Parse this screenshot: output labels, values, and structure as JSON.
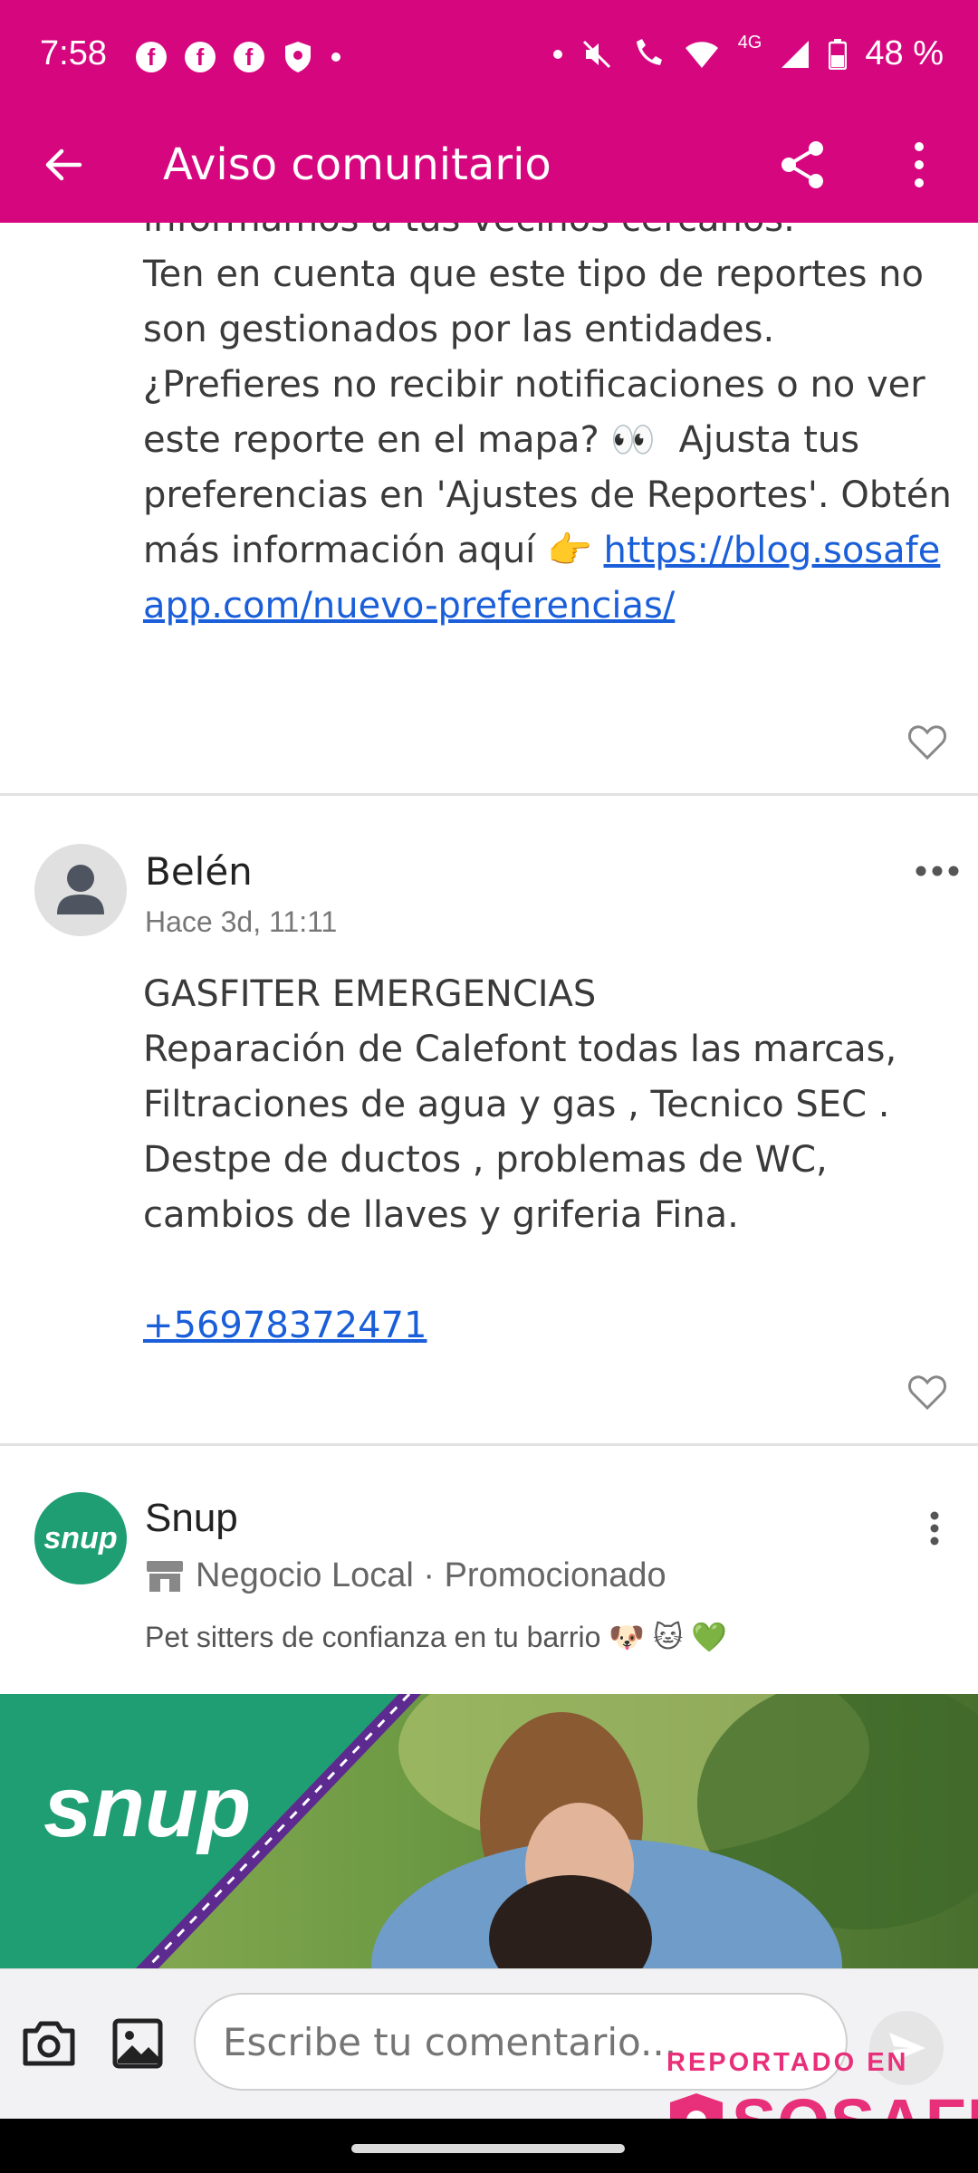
{
  "status_bar": {
    "time": "7:58",
    "battery": "48 %",
    "network": "4G",
    "icons": [
      "facebook-icon",
      "facebook-icon",
      "facebook-icon",
      "shield-icon",
      "mute-icon",
      "wifi-call-icon",
      "wifi-icon",
      "signal-icon",
      "battery-icon"
    ]
  },
  "app_bar": {
    "title": "Aviso comunitario",
    "background_color": "#d6067f"
  },
  "post1": {
    "text": "informamos a tus vecinos cercanos.\nTen en cuenta que este tipo de reportes no son gestionados por las entidades. ¿Prefieres no recibir notificaciones o no ver este reporte en el mapa? 👀  Ajusta tus preferencias en 'Ajustes de Reportes'. Obtén más información aquí 👉 ",
    "link": "https://blog.sosafeapp.com/nuevo-preferencias/"
  },
  "post2": {
    "author": "Belén",
    "time": "Hace 3d, 11:11",
    "text": "GASFITER EMERGENCIAS\nReparación de Calefont todas las marcas, Filtraciones de agua y gas , Tecnico SEC . Destpe de ductos , problemas de WC, cambios de llaves y griferia Fina.",
    "phone": "+56978372471"
  },
  "promo": {
    "brand": "Snup",
    "avatar_text": "snup",
    "sponsor_line": "Negocio Local · Promocionado",
    "description": "Pet sitters de confianza en tu barrio 🐶 🐱 💚",
    "banner_logo": "snup",
    "brand_color": "#1e9e72"
  },
  "comment_bar": {
    "placeholder": "Escribe tu comentario..."
  },
  "watermark": {
    "label": "REPORTADO EN",
    "brand": "SOSAFE",
    "color": "#e8307a"
  }
}
